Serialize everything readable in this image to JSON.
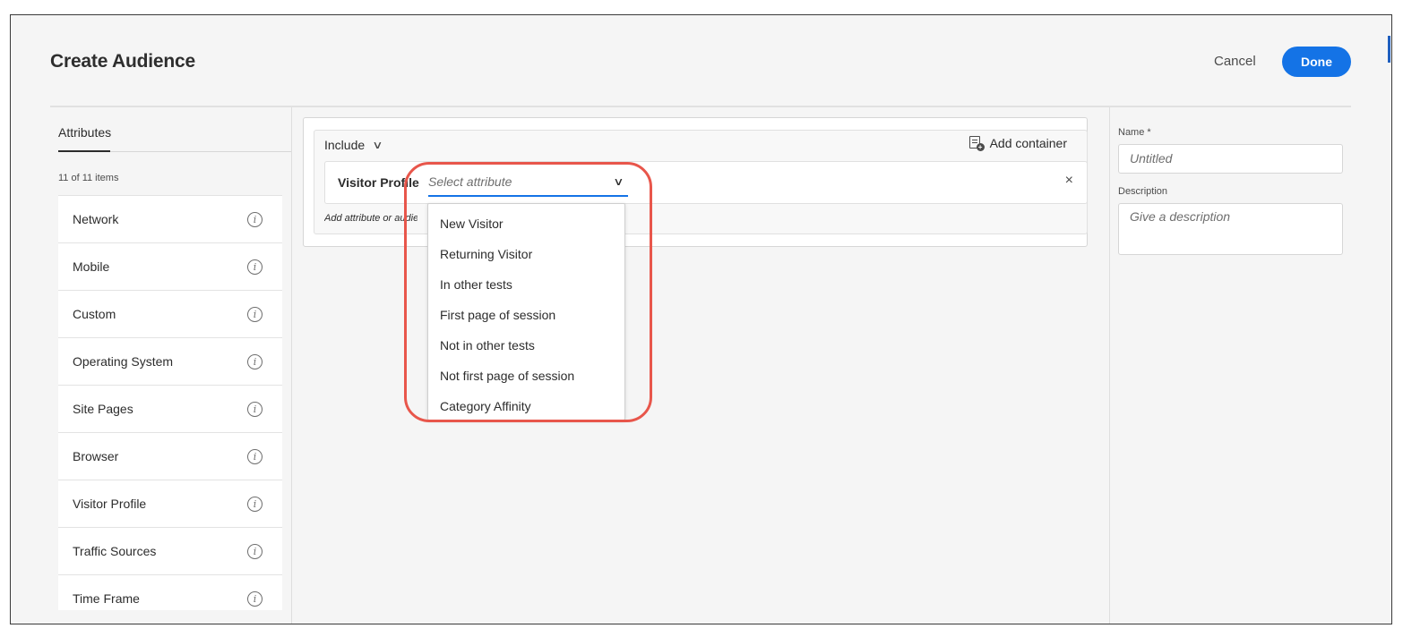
{
  "header": {
    "title": "Create Audience",
    "cancel_label": "Cancel",
    "done_label": "Done"
  },
  "attributes_panel": {
    "tab_label": "Attributes",
    "count_text": "11 of 11 items",
    "items": [
      {
        "label": "Network",
        "icon": "info-icon"
      },
      {
        "label": "Mobile",
        "icon": "info-icon"
      },
      {
        "label": "Custom",
        "icon": "info-icon"
      },
      {
        "label": "Operating System",
        "icon": "info-icon"
      },
      {
        "label": "Site Pages",
        "icon": "info-icon"
      },
      {
        "label": "Browser",
        "icon": "info-icon"
      },
      {
        "label": "Visitor Profile",
        "icon": "info-icon"
      },
      {
        "label": "Traffic Sources",
        "icon": "info-icon"
      },
      {
        "label": "Time Frame",
        "icon": "info-icon"
      }
    ]
  },
  "builder": {
    "include_label": "Include",
    "add_container_label": "Add container",
    "rule": {
      "attribute_label": "Visitor Profile",
      "select_placeholder": "Select attribute",
      "remove_symbol": "×"
    },
    "add_hint": "Add attribute or audience",
    "dropdown_options": [
      "New Visitor",
      "Returning Visitor",
      "In other tests",
      "First page of session",
      "Not in other tests",
      "Not first page of session",
      "Category Affinity"
    ],
    "highlight_color": "#e8564b"
  },
  "details_panel": {
    "name_label": "Name *",
    "name_placeholder": "Untitled",
    "description_label": "Description",
    "description_placeholder": "Give a description"
  },
  "colors": {
    "accent": "#1473e6",
    "background": "#f5f5f5"
  }
}
